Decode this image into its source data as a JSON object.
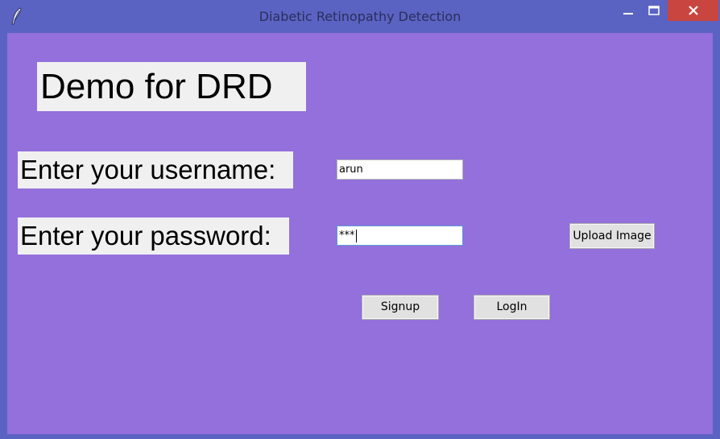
{
  "window": {
    "title": "Diabetic Retinopathy Detection",
    "icons": {
      "app": "feather-icon",
      "minimize": "minimize-icon",
      "maximize": "maximize-icon",
      "close": "close-icon"
    },
    "colors": {
      "titlebar": "#5b63c2",
      "client_background": "#9370db",
      "close_button": "#c8463f"
    }
  },
  "form": {
    "heading": "Demo for DRD",
    "username_label": "Enter your username:",
    "password_label": "Enter your password:",
    "username_value": "arun",
    "password_value": "***",
    "upload_button": "Upload Image",
    "signup_button": "Signup",
    "login_button": "LogIn"
  }
}
